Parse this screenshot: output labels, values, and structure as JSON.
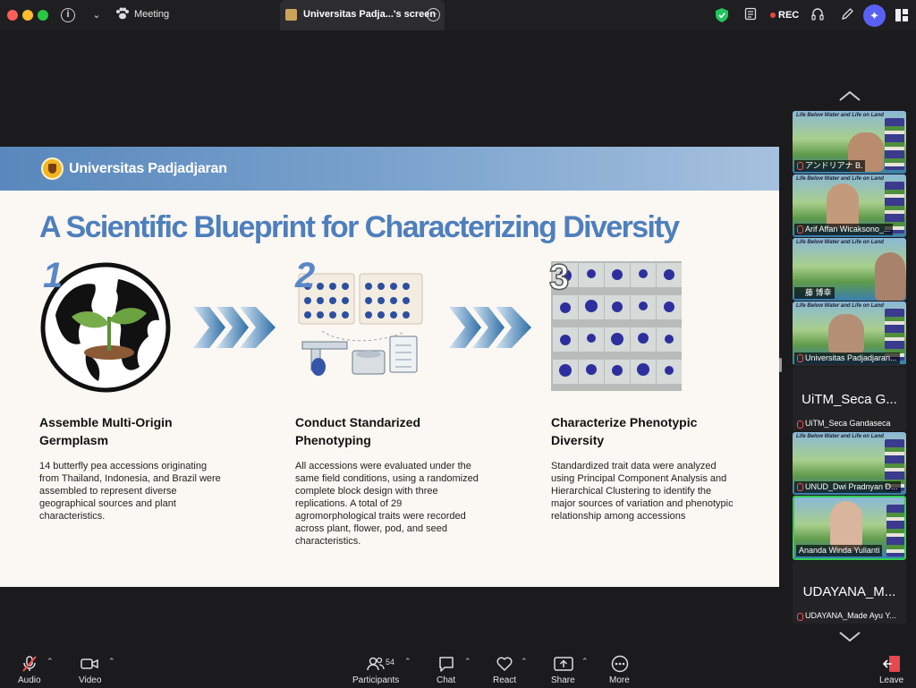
{
  "window": {
    "meeting_label": "Meeting",
    "share_tab_label": "Universitas Padja...'s screen",
    "rec_label": "REC"
  },
  "slide": {
    "university": "Universitas Padjadjaran",
    "title": "A Scientific Blueprint for Characterizing Diversity",
    "steps": [
      {
        "number": "1",
        "heading_line1": "Assemble Multi-Origin",
        "heading_line2": "Germplasm",
        "description": "14 butterfly pea accessions originating from Thailand, Indonesia, and Brazil were assembled to represent diverse geographical sources and plant characteristics."
      },
      {
        "number": "2",
        "heading_line1": "Conduct Standarized",
        "heading_line2": "Phenotyping",
        "description": "All accessions were evaluated under the same field conditions, using a randomized complete block design with three replications. A total of 29 agromorphological traits were recorded across plant, flower, pod, and seed characteristics."
      },
      {
        "number": "3",
        "heading_line1": "Characterize Phenotypic",
        "heading_line2": "Diversity",
        "description": "Standardized trait data were analyzed using Principal Component Analysis and Hierarchical Clustering to identify the major sources of variation and phenotypic relationship among accessions"
      }
    ]
  },
  "gallery": {
    "banner_text": "Life Below Water and Life on Land",
    "participants": [
      {
        "name": "アンドリアナ B."
      },
      {
        "name": "Arif Affan Wicaksono_..."
      },
      {
        "name": "藤 博幸"
      },
      {
        "name": "Universitas Padjadjaran..."
      },
      {
        "display": "UiTM_Seca G...",
        "name": "UiTM_Seca Gandaseca"
      },
      {
        "name": "UNUD_Dwi Pradnyan D..."
      },
      {
        "name": "Ananda Winda Yulianti"
      },
      {
        "display": "UDAYANA_M...",
        "name": "UDAYANA_Made Ayu Y..."
      }
    ]
  },
  "toolbar": {
    "audio": "Audio",
    "video": "Video",
    "participants": "Participants",
    "participants_count": "54",
    "chat": "Chat",
    "react": "React",
    "share": "Share",
    "more": "More",
    "leave": "Leave"
  },
  "colors": {
    "accent_blue": "#4e7fbd",
    "active_speaker": "#2fcf4f",
    "ai_button": "#5961f5",
    "rec_red": "#f04444"
  }
}
